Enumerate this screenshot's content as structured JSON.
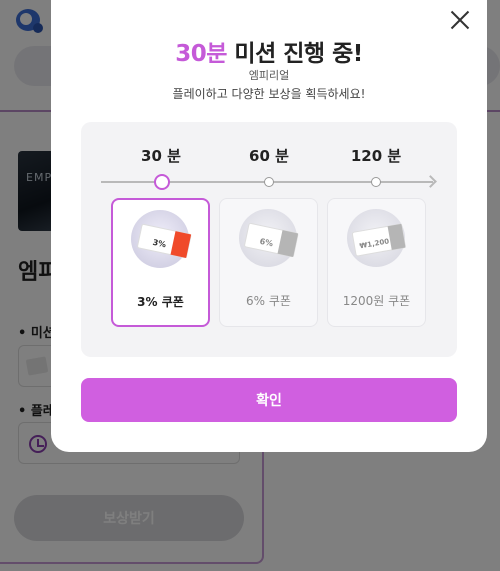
{
  "background": {
    "thumbnail_text": "EMPI",
    "game_title": "엠피",
    "bullet_mission": "• 미션",
    "bullet_play": "• 플레",
    "reward_button": "보상받기"
  },
  "modal": {
    "title_accent": "30분",
    "title_rest": " 미션 진행 중!",
    "game_name": "엠피리얼",
    "description": "플레이하고 다양한 보상을 획득하세요!",
    "milestones": [
      {
        "time": "30 분",
        "coupon_label": "3% 쿠폰",
        "ticket_value": "3%",
        "active": true
      },
      {
        "time": "60 분",
        "coupon_label": "6% 쿠폰",
        "ticket_value": "6%",
        "active": false
      },
      {
        "time": "120 분",
        "coupon_label": "1200원 쿠폰",
        "ticket_value": "₩1,200",
        "active": false
      }
    ],
    "confirm_label": "확인"
  },
  "colors": {
    "accent": "#c55ad8",
    "button": "#d05fe0",
    "ticket_active": "#f04a2a",
    "ticket_inactive": "#b5b5b5"
  },
  "icons": [
    "close-icon",
    "clock-icon",
    "coupon-icon",
    "arrow-right-icon"
  ]
}
